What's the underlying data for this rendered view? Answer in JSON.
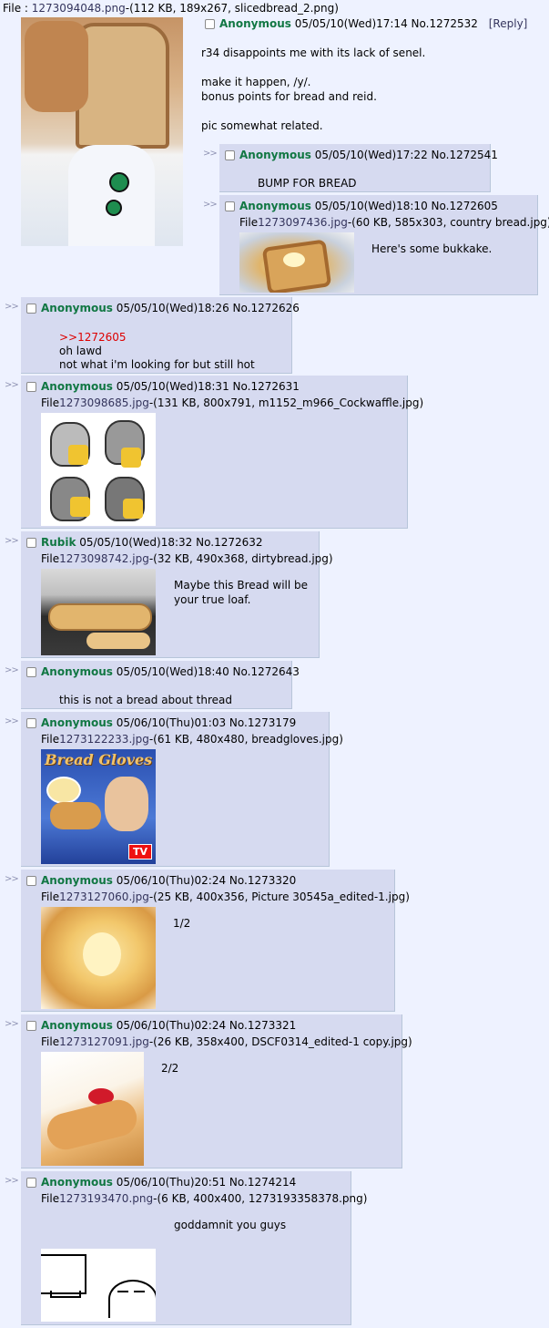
{
  "op": {
    "file_label": "File : ",
    "file_link": "1273094048.png",
    "file_meta": "-(112 KB, 189x267, slicedbread_2.png)",
    "name": "Anonymous",
    "datetime": "05/05/10(Wed)17:14",
    "number": "No.1272532",
    "reply_link": "[Reply]",
    "message": [
      "r34 disappoints me with its lack of senel.",
      "",
      "make it happen, /y/.",
      "bonus points for bread and reid.",
      "",
      "pic somewhat related."
    ]
  },
  "replies": [
    {
      "name": "Anonymous",
      "datetime": "05/05/10(Wed)17:22",
      "number": "No.1272541",
      "message": [
        "BUMP FOR BREAD"
      ]
    },
    {
      "name": "Anonymous",
      "datetime": "05/05/10(Wed)18:10",
      "number": "No.1272605",
      "file_label": "File",
      "file_link": "1273097436.jpg",
      "file_meta": "-(60 KB, 585x303, country bread.jpg)",
      "message": [
        "Here's some bukkake."
      ]
    },
    {
      "name": "Anonymous",
      "datetime": "05/05/10(Wed)18:26",
      "number": "No.1272626",
      "quote": ">>1272605",
      "message": [
        "oh lawd",
        "not what i'm looking for but still hot"
      ]
    },
    {
      "name": "Anonymous",
      "datetime": "05/05/10(Wed)18:31",
      "number": "No.1272631",
      "file_label": "File",
      "file_link": "1273098685.jpg",
      "file_meta": "-(131 KB, 800x791, m1152_m966_Cockwaffle.jpg)",
      "message": []
    },
    {
      "name": "Rubik",
      "datetime": "05/05/10(Wed)18:32",
      "number": "No.1272632",
      "file_label": "File",
      "file_link": "1273098742.jpg",
      "file_meta": "-(32 KB, 490x368, dirtybread.jpg)",
      "message": [
        "Maybe this Bread will be",
        "your true loaf."
      ]
    },
    {
      "name": "Anonymous",
      "datetime": "05/05/10(Wed)18:40",
      "number": "No.1272643",
      "message": [
        "this is not a bread about thread"
      ]
    },
    {
      "name": "Anonymous",
      "datetime": "05/06/10(Thu)01:03",
      "number": "No.1273179",
      "file_label": "File",
      "file_link": "1273122233.jpg",
      "file_meta": "-(61 KB, 480x480, breadgloves.jpg)",
      "message": []
    },
    {
      "name": "Anonymous",
      "datetime": "05/06/10(Thu)02:24",
      "number": "No.1273320",
      "file_label": "File",
      "file_link": "1273127060.jpg",
      "file_meta": "-(25 KB, 400x356, Picture 30545a_edited-1.jpg)",
      "message": [
        "1/2"
      ]
    },
    {
      "name": "Anonymous",
      "datetime": "05/06/10(Thu)02:24",
      "number": "No.1273321",
      "file_label": "File",
      "file_link": "1273127091.jpg",
      "file_meta": "-(26 KB, 358x400, DSCF0314_edited-1 copy.jpg)",
      "message": [
        "2/2"
      ]
    },
    {
      "name": "Anonymous",
      "datetime": "05/06/10(Thu)20:51",
      "number": "No.1274214",
      "file_label": "File",
      "file_link": "1273193470.png",
      "file_meta": "-(6 KB, 400x400, 1273193358378.png)",
      "message": [
        "goddamnit you guys"
      ]
    }
  ],
  "thumb_text": {
    "gloves_title": "Bread Gloves",
    "gloves_badge": "TV"
  },
  "colors": {
    "name": "#117743",
    "quote": "#dd0000",
    "link": "#34345c",
    "reply_bg": "#d6daf0",
    "page_bg": "#eef2ff"
  }
}
